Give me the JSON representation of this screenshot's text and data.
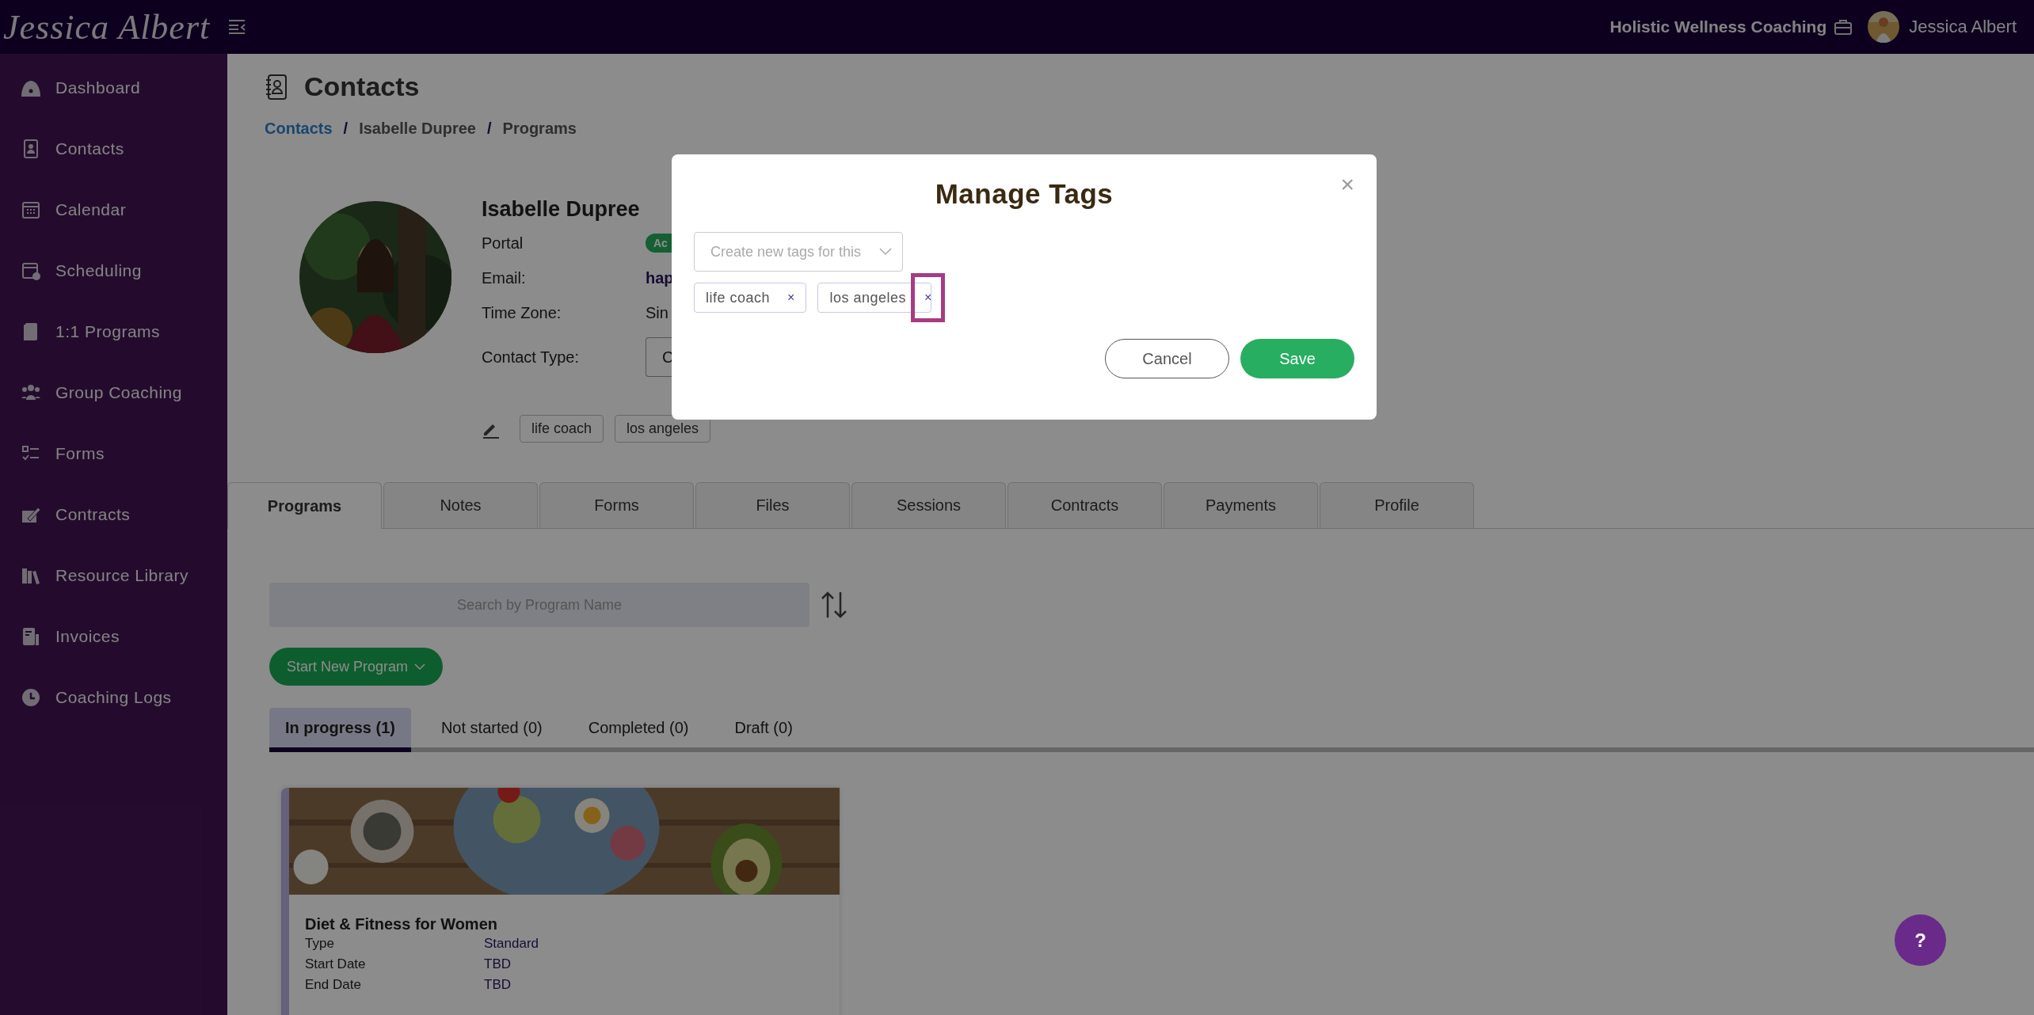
{
  "header": {
    "logo": "Jessica Albert",
    "business": "Holistic Wellness Coaching",
    "user": "Jessica Albert"
  },
  "sidebar": {
    "items": [
      {
        "label": "Dashboard"
      },
      {
        "label": "Contacts"
      },
      {
        "label": "Calendar"
      },
      {
        "label": "Scheduling"
      },
      {
        "label": "1:1 Programs"
      },
      {
        "label": "Group Coaching"
      },
      {
        "label": "Forms"
      },
      {
        "label": "Contracts"
      },
      {
        "label": "Resource Library"
      },
      {
        "label": "Invoices"
      },
      {
        "label": "Coaching Logs"
      }
    ]
  },
  "page": {
    "title": "Contacts",
    "breadcrumb": [
      {
        "label": "Contacts",
        "link": true
      },
      {
        "separator": "/",
        "label": "Isabelle Dupree",
        "link": false
      },
      {
        "separator": "/",
        "label": "Programs",
        "link": false
      }
    ]
  },
  "contact": {
    "name": "Isabelle Dupree",
    "fields": [
      {
        "label": "Portal",
        "value": "Ac",
        "kind": "badge"
      },
      {
        "label": "Email:",
        "value": "hap",
        "kind": "link"
      },
      {
        "label": "Time Zone:",
        "value": "Sin",
        "kind": "text"
      },
      {
        "label": "Contact Type:",
        "value": "C",
        "kind": "select"
      }
    ],
    "tags": [
      "life coach",
      "los angeles"
    ]
  },
  "tabs": [
    {
      "label": "Programs",
      "selected": true
    },
    {
      "label": "Notes",
      "selected": false
    },
    {
      "label": "Forms",
      "selected": false
    },
    {
      "label": "Files",
      "selected": false
    },
    {
      "label": "Sessions",
      "selected": false
    },
    {
      "label": "Contracts",
      "selected": false
    },
    {
      "label": "Payments",
      "selected": false
    },
    {
      "label": "Profile",
      "selected": false
    }
  ],
  "search": {
    "placeholder": "Search by Program Name"
  },
  "start_button": "Start New Program",
  "status_tabs": [
    {
      "label": "In progress (1)",
      "selected": true
    },
    {
      "label": "Not started (0)",
      "selected": false
    },
    {
      "label": "Completed (0)",
      "selected": false
    },
    {
      "label": "Draft (0)",
      "selected": false
    }
  ],
  "programs": [
    {
      "title": "Diet & Fitness for Women",
      "details": [
        {
          "label": "Type",
          "value": "Standard"
        },
        {
          "label": "Start Date",
          "value": "TBD"
        },
        {
          "label": "End Date",
          "value": "TBD"
        }
      ]
    }
  ],
  "help_button": "?",
  "modal": {
    "title": "Manage Tags",
    "close": "×",
    "input": {
      "placeholder": "Create new tags for this"
    },
    "tags": [
      {
        "label": "life coach",
        "remove": "×",
        "highlighted": false
      },
      {
        "label": "los angeles",
        "remove": "×",
        "highlighted": true
      }
    ],
    "buttons": [
      {
        "label": "Cancel",
        "kind": "secondary"
      },
      {
        "label": "Save",
        "kind": "primary"
      }
    ]
  }
}
